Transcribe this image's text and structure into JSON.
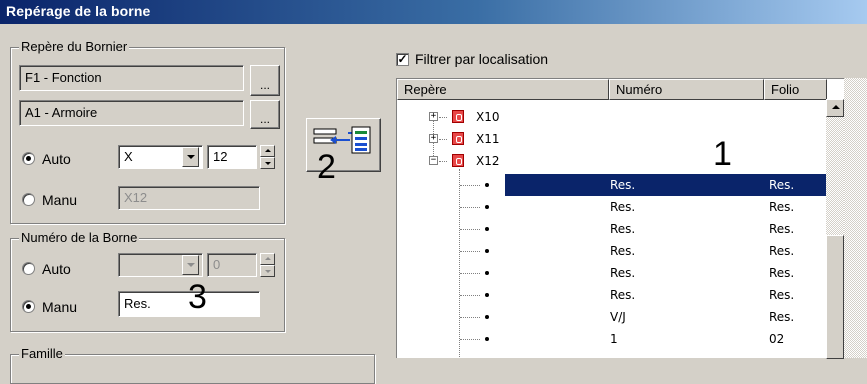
{
  "window": {
    "title": "Repérage de la borne"
  },
  "bornier_group": {
    "legend": "Repère du Bornier",
    "fonction_value": "F1 - Fonction",
    "armoire_value": "A1 - Armoire",
    "browse_label": "...",
    "auto_label": "Auto",
    "auto_selected": true,
    "auto_combo_value": "X",
    "auto_spin_value": "12",
    "manu_label": "Manu",
    "manu_value": "X12",
    "annotation": "2"
  },
  "numero_group": {
    "legend": "Numéro de la Borne",
    "auto_label": "Auto",
    "auto_spin_value": "0",
    "manu_label": "Manu",
    "manu_selected": true,
    "manu_value": "Res.",
    "annotation": "3"
  },
  "famille_group": {
    "legend": "Famille"
  },
  "filter": {
    "label": "Filtrer par localisation",
    "checked": true,
    "check_glyph": "✓"
  },
  "tree": {
    "annotation": "1",
    "columns": [
      "Repère",
      "Numéro",
      "Folio"
    ],
    "expander_plus": "+",
    "expander_minus": "−",
    "nodes": [
      {
        "label": "X10",
        "expanded": false
      },
      {
        "label": "X11",
        "expanded": false
      },
      {
        "label": "X12",
        "expanded": true
      }
    ],
    "rows": [
      {
        "numero": "Res.",
        "folio": "Res.",
        "selected": true
      },
      {
        "numero": "Res.",
        "folio": "Res."
      },
      {
        "numero": "Res.",
        "folio": "Res."
      },
      {
        "numero": "Res.",
        "folio": "Res."
      },
      {
        "numero": "Res.",
        "folio": "Res."
      },
      {
        "numero": "Res.",
        "folio": "Res."
      },
      {
        "numero": "V/J",
        "folio": "Res."
      },
      {
        "numero": "1",
        "folio": "02"
      }
    ]
  },
  "colors": {
    "title_start": "#0a246a",
    "selection": "#0a246a",
    "node_icon": "#e84848",
    "face": "#d4d0c8"
  }
}
